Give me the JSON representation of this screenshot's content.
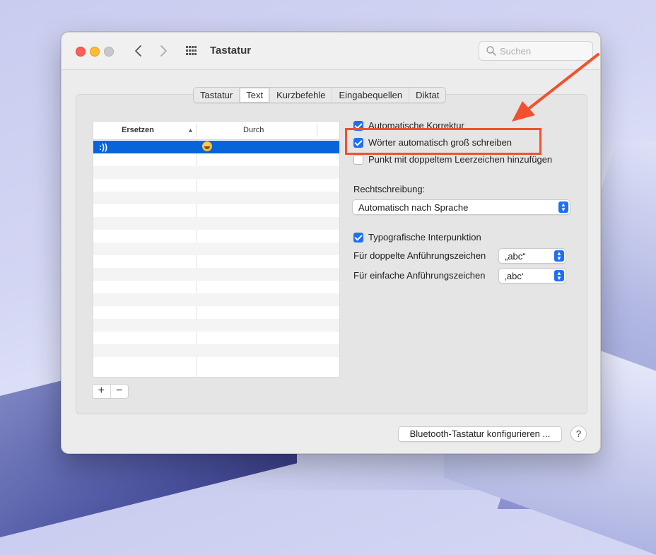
{
  "window": {
    "title": "Tastatur",
    "search_placeholder": "Suchen"
  },
  "tabs": [
    {
      "label": "Tastatur",
      "active": false
    },
    {
      "label": "Text",
      "active": true
    },
    {
      "label": "Kurzbefehle",
      "active": false
    },
    {
      "label": "Eingabequellen",
      "active": false
    },
    {
      "label": "Diktat",
      "active": false
    }
  ],
  "table": {
    "col1_header": "Ersetzen",
    "col2_header": "Durch",
    "rows": [
      {
        "replace": ":))",
        "with_icon": "laughing-emoji-icon",
        "selected": true
      }
    ]
  },
  "options": {
    "auto_correct": {
      "label": "Automatische Korrektur",
      "checked": true
    },
    "auto_capitalize": {
      "label": "Wörter automatisch groß schreiben",
      "checked": true
    },
    "double_space_period": {
      "label": "Punkt mit doppeltem Leerzeichen hinzufügen",
      "checked": false
    },
    "spelling_label": "Rechtschreibung:",
    "spelling_value": "Automatisch nach Sprache",
    "smart_punctuation": {
      "label": "Typografische Interpunktion",
      "checked": true
    },
    "double_quotes_label": "Für doppelte Anführungszeichen",
    "double_quotes_value": "„abc“",
    "single_quotes_label": "Für einfache Anführungszeichen",
    "single_quotes_value": "‚abc‘"
  },
  "footer": {
    "bluetooth_button": "Bluetooth-Tastatur konfigurieren ...",
    "help_label": "?"
  },
  "buttons": {
    "add": "+",
    "remove": "−"
  },
  "annotation": {
    "color": "#f2512d"
  }
}
